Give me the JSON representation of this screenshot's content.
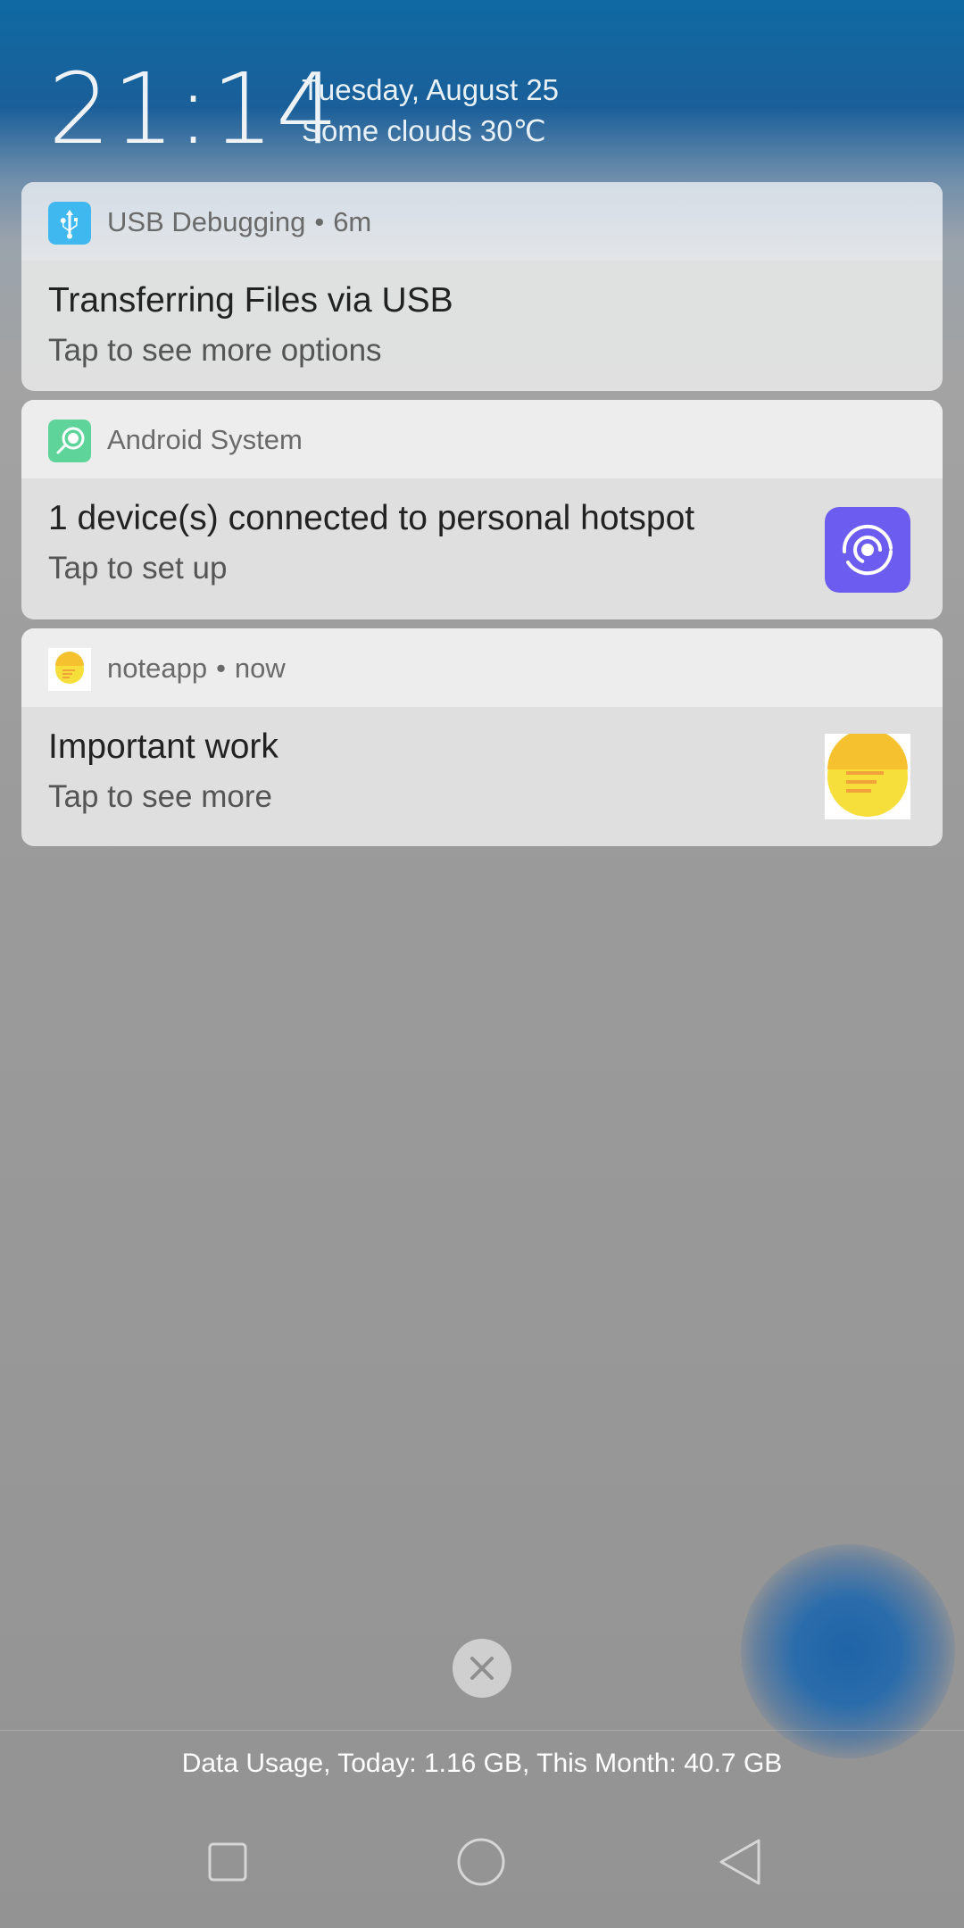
{
  "lockscreen": {
    "time": "21:14",
    "date": "Tuesday, August 25",
    "weather": "Some clouds 30℃"
  },
  "notifications": [
    {
      "app": "USB Debugging",
      "time": "6m",
      "title": "Transferring Files via USB",
      "text": "Tap to see more options",
      "icon": "usb-icon",
      "icon_color": "#3fb8f0"
    },
    {
      "app": "Android System",
      "title": "1 device(s) connected to personal hotspot",
      "text": "Tap to set up",
      "icon": "hotspot-app-icon",
      "icon_color": "#5ed39a",
      "thumb": "hotspot-icon",
      "thumb_color": "#6c5cf0"
    },
    {
      "app": "noteapp",
      "time": "now",
      "title": "Important work",
      "text": "Tap to see more",
      "icon": "note-icon",
      "icon_color": "#f6de3b",
      "thumb": "note-icon"
    }
  ],
  "clear_all": {
    "icon": "close-icon"
  },
  "footer": {
    "data_usage": "Data Usage, Today: 1.16 GB, This Month: 40.7 GB"
  },
  "navbar": {
    "recents_icon": "square-icon",
    "home_icon": "circle-icon",
    "back_icon": "triangle-back-icon"
  }
}
